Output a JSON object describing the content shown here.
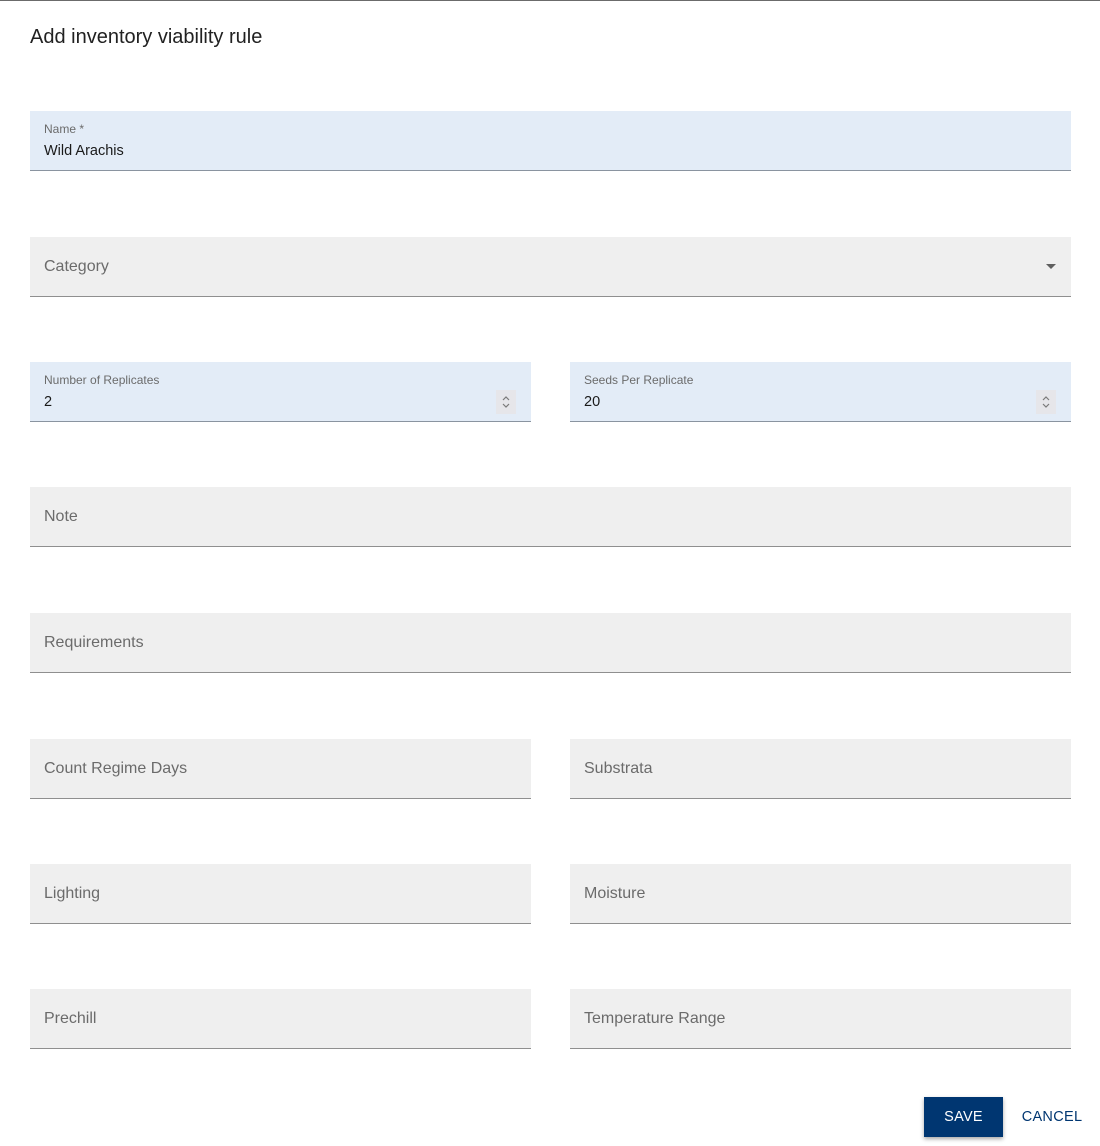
{
  "dialog": {
    "title": "Add inventory viability rule"
  },
  "fields": {
    "name": {
      "label": "Name *",
      "value": "Wild Arachis"
    },
    "category": {
      "placeholder": "Category",
      "icon": "caret-down-icon"
    },
    "replicates": {
      "label": "Number of Replicates",
      "value": "2",
      "icon": "spinner-icon"
    },
    "seeds_per_replicate": {
      "label": "Seeds Per Replicate",
      "value": "20",
      "icon": "spinner-icon"
    },
    "note": {
      "placeholder": "Note"
    },
    "requirements": {
      "placeholder": "Requirements"
    },
    "count_regime_days": {
      "placeholder": "Count Regime Days"
    },
    "substrata": {
      "placeholder": "Substrata"
    },
    "lighting": {
      "placeholder": "Lighting"
    },
    "moisture": {
      "placeholder": "Moisture"
    },
    "prechill": {
      "placeholder": "Prechill"
    },
    "temperature_range": {
      "placeholder": "Temperature Range"
    }
  },
  "actions": {
    "save_label": "SAVE",
    "cancel_label": "CANCEL"
  },
  "colors": {
    "primary": "#003671",
    "filled_field_bg": "#e3ecf7",
    "empty_field_bg": "#efefef"
  }
}
